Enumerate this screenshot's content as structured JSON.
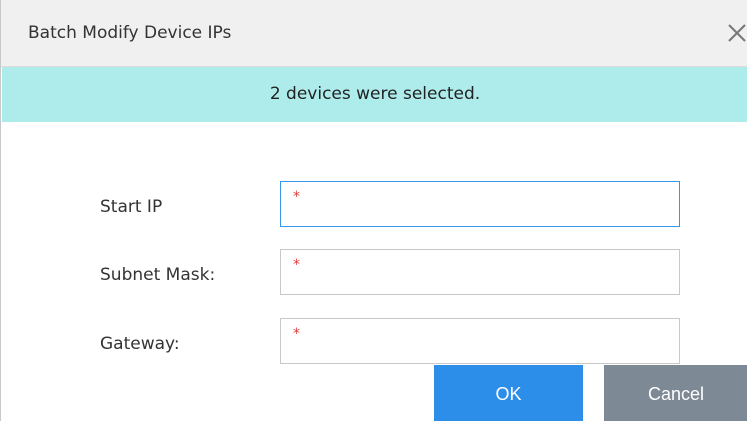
{
  "dialog": {
    "title": "Batch Modify Device IPs",
    "close_icon": "close-icon"
  },
  "banner": {
    "text": "2 devices were selected.",
    "color": "#aeecec"
  },
  "form": {
    "start_ip": {
      "label": "Start IP",
      "value": "",
      "required_mark": "*"
    },
    "subnet_mask": {
      "label": "Subnet Mask:",
      "value": "",
      "required_mark": "*"
    },
    "gateway": {
      "label": "Gateway:",
      "value": "",
      "required_mark": "*"
    }
  },
  "buttons": {
    "ok_label": "OK",
    "cancel_label": "Cancel",
    "ok_color": "#2d8ee9",
    "cancel_color": "#7d8a96"
  }
}
